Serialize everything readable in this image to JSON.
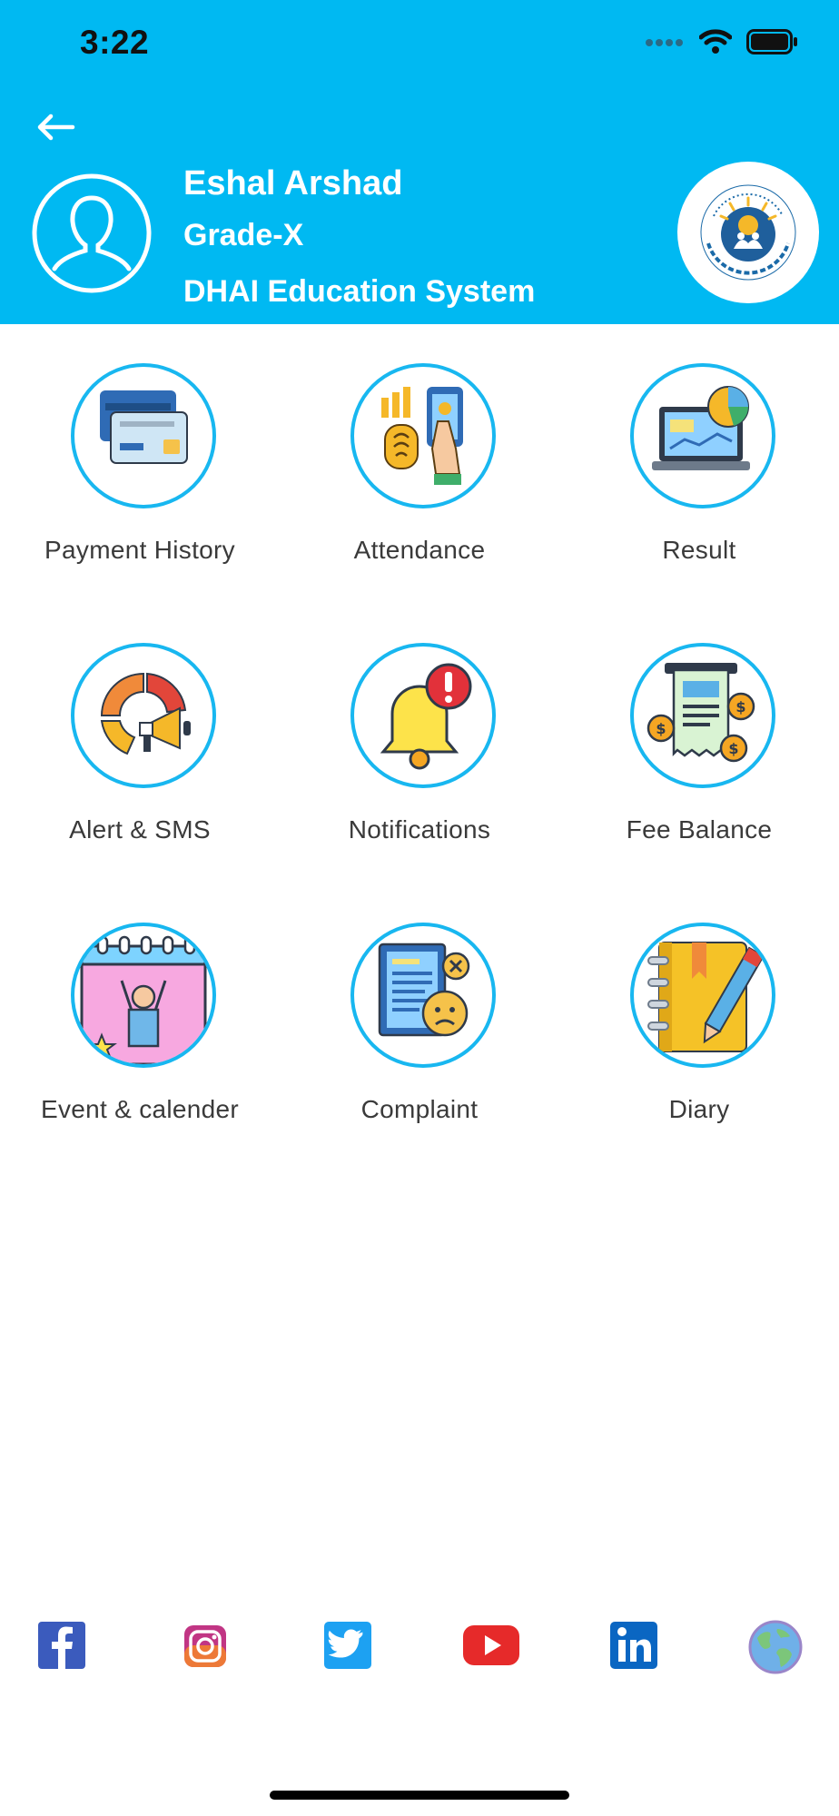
{
  "status_bar": {
    "time": "3:22"
  },
  "header": {
    "student_name": "Eshal Arshad",
    "grade": "Grade-X",
    "school": "DHAI Education System",
    "logo_text": "RISE TO EXCELLENCE · DHAI EDUCATION SYSTEM",
    "colors": {
      "background": "#00b9f2",
      "text": "#ffffff"
    }
  },
  "menu": [
    {
      "label": "Payment History",
      "icon": "payment-history-icon"
    },
    {
      "label": "Attendance",
      "icon": "attendance-icon"
    },
    {
      "label": "Result",
      "icon": "result-icon"
    },
    {
      "label": "Alert & SMS",
      "icon": "alert-sms-icon"
    },
    {
      "label": "Notifications",
      "icon": "notifications-icon"
    },
    {
      "label": "Fee Balance",
      "icon": "fee-balance-icon"
    },
    {
      "label": "Event & calender",
      "icon": "event-calendar-icon"
    },
    {
      "label": "Complaint",
      "icon": "complaint-icon"
    },
    {
      "label": "Diary",
      "icon": "diary-icon"
    }
  ],
  "social_links": [
    {
      "name": "facebook-icon"
    },
    {
      "name": "instagram-icon"
    },
    {
      "name": "twitter-icon"
    },
    {
      "name": "youtube-icon"
    },
    {
      "name": "linkedin-icon"
    },
    {
      "name": "website-globe-icon"
    }
  ],
  "accent_color": "#18b7f0"
}
